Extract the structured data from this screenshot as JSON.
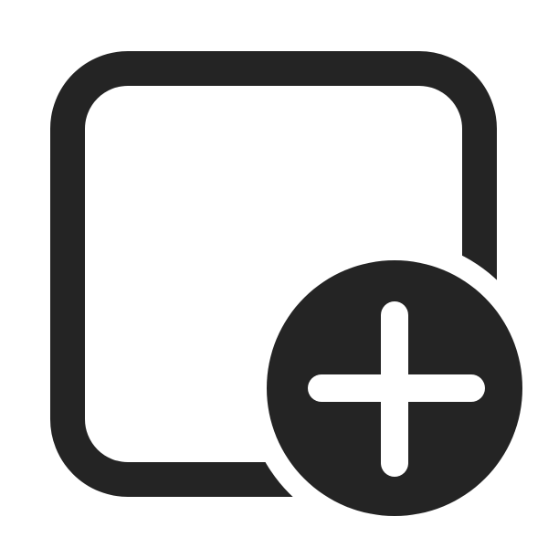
{
  "icon": {
    "name": "add-square-icon",
    "components": [
      "rounded-square-outline",
      "plus-circle-badge"
    ],
    "colors": {
      "foreground": "#242424",
      "background": "#ffffff"
    }
  }
}
